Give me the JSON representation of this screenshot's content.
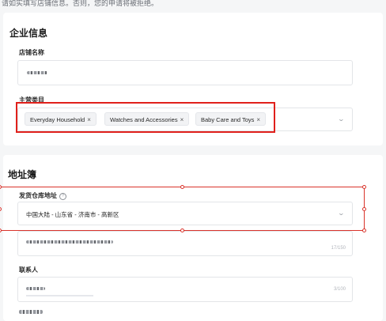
{
  "notice": "请如实填写店铺信息。否则，您的申请将被拒绝。",
  "company_section": {
    "title": "企业信息",
    "store_name_label": "店铺名称",
    "main_category_label": "主营类目",
    "categories": [
      {
        "label": "Everyday Household",
        "remove": "×"
      },
      {
        "label": "Watches and Accessories",
        "remove": "×"
      },
      {
        "label": "Baby Care and Toys",
        "remove": "×"
      }
    ]
  },
  "address_section": {
    "title": "地址簿",
    "warehouse_label": "发货仓库地址",
    "help_icon_glyph": "?",
    "warehouse_value": "中国大陆 - 山东省 - 济南市 - 高新区",
    "detail_counter": "17/150",
    "contact_label": "联系人",
    "contact_counter": "3/100"
  },
  "icons": {
    "chevron": "⌄"
  },
  "colors": {
    "highlight_red": "#e0201b",
    "card_bg": "#ffffff",
    "page_bg": "#f5f6f7"
  }
}
